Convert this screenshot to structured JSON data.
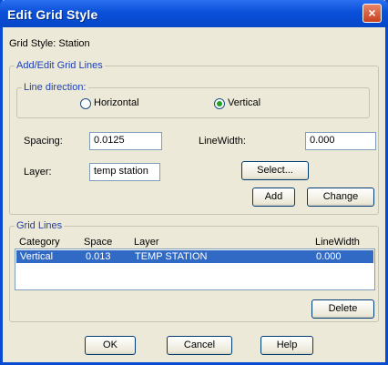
{
  "window": {
    "title": "Edit Grid Style",
    "close_glyph": "×"
  },
  "grid_style": {
    "label": "Grid Style: Station"
  },
  "add_edit_group": {
    "legend": "Add/Edit Grid Lines",
    "line_direction": {
      "legend": "Line direction:",
      "horizontal_label": "Horizontal",
      "vertical_label": "Vertical",
      "selected": "Vertical"
    },
    "spacing_label": "Spacing:",
    "spacing_value": "0.0125",
    "linewidth_label": "LineWidth:",
    "linewidth_value": "0.000",
    "layer_label": "Layer:",
    "layer_value": "temp station",
    "select_button": "Select...",
    "add_button": "Add",
    "change_button": "Change"
  },
  "grid_lines_group": {
    "legend": "Grid Lines",
    "columns": [
      "Category",
      "Space",
      "Layer",
      "LineWidth"
    ],
    "rows": [
      {
        "category": "Vertical",
        "space": "0.013",
        "layer": "TEMP STATION",
        "linewidth": "0.000",
        "selected": true
      }
    ],
    "delete_button": "Delete"
  },
  "footer": {
    "ok_button": "OK",
    "cancel_button": "Cancel",
    "help_button": "Help"
  },
  "colors": {
    "title_bar": "#0a50d9",
    "selection": "#316ac5",
    "group_legend": "#1b3fb6"
  }
}
